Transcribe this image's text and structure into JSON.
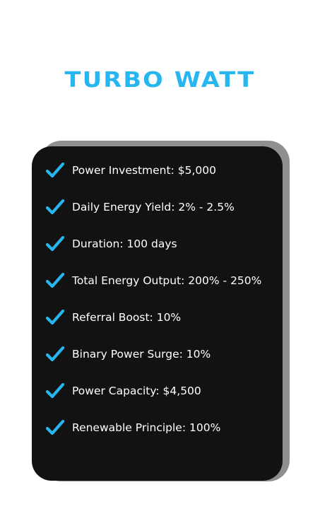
{
  "colors": {
    "accent": "#27b6ef",
    "card_bg": "#121212",
    "card_shadow": "#8f8f8f",
    "text": "#ffffff",
    "page_bg": "#ffffff"
  },
  "title": "TURBO WATT",
  "features": [
    {
      "icon": "checkmark-icon",
      "label": "Power Investment: $5,000"
    },
    {
      "icon": "checkmark-icon",
      "label": "Daily Energy Yield: 2% - 2.5%"
    },
    {
      "icon": "checkmark-icon",
      "label": "Duration: 100 days"
    },
    {
      "icon": "checkmark-icon",
      "label": "Total Energy Output: 200% - 250%"
    },
    {
      "icon": "checkmark-icon",
      "label": "Referral Boost: 10%"
    },
    {
      "icon": "checkmark-icon",
      "label": "Binary Power Surge: 10%"
    },
    {
      "icon": "checkmark-icon",
      "label": "Power Capacity: $4,500"
    },
    {
      "icon": "checkmark-icon",
      "label": "Renewable Principle: 100%"
    }
  ]
}
